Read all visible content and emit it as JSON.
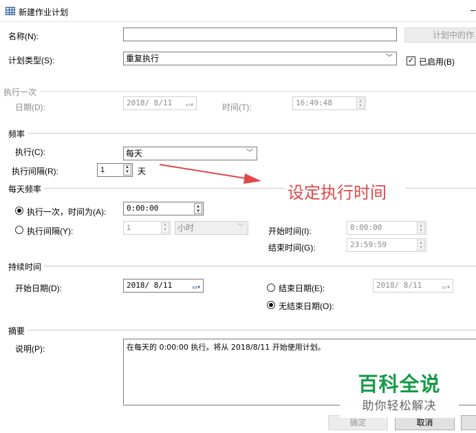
{
  "window": {
    "title": "新建作业计划",
    "minimize": "–"
  },
  "general": {
    "name_label": "名称(N):",
    "name_value": "",
    "jobs_in_schedule_button": "计划中的作",
    "schedule_type_label": "计划类型(S):",
    "schedule_type_value": "重复执行",
    "enabled_label": "已启用(B)",
    "enabled_mark": "✓"
  },
  "one_time": {
    "section_label": "执行一次",
    "date_label": "日期(D):",
    "date_value": "2018/ 8/11",
    "time_label": "时间(T):",
    "time_value": "16:49:48"
  },
  "frequency": {
    "section_label": "频率",
    "occurs_label": "执行(C):",
    "occurs_value": "每天",
    "recurs_label": "执行间隔(R):",
    "recurs_value": "1",
    "recurs_unit": "天"
  },
  "daily_frequency": {
    "section_label": "每天频率",
    "once_label": "执行一次，时间为(A):",
    "once_time": "0:00:00",
    "every_label": "执行间隔(Y):",
    "every_value": "1",
    "every_unit": "小时",
    "start_time_label": "开始时间(I):",
    "start_time_value": "0:00:00",
    "end_time_label": "结束时间(G):",
    "end_time_value": "23:59:59"
  },
  "duration": {
    "section_label": "持续时间",
    "start_date_label": "开始日期(D):",
    "start_date_value": "2018/ 8/11",
    "end_date_label": "结束日期(E):",
    "end_date_value": "2018/ 8/11",
    "no_end_label": "无结束日期(O):"
  },
  "summary": {
    "section_label": "摘要",
    "description_label": "说明(P):",
    "description_text": "在每天的 0:00:00 执行。将从 2018/8/11 开始使用计划。"
  },
  "annotation": {
    "text": "设定执行时间",
    "color": "#e04848"
  },
  "watermark": {
    "line1": "百科全说",
    "line2": "助你轻松解决",
    "color": "#169b47"
  },
  "buttons": {
    "ok": "确定",
    "cancel": "取消"
  }
}
